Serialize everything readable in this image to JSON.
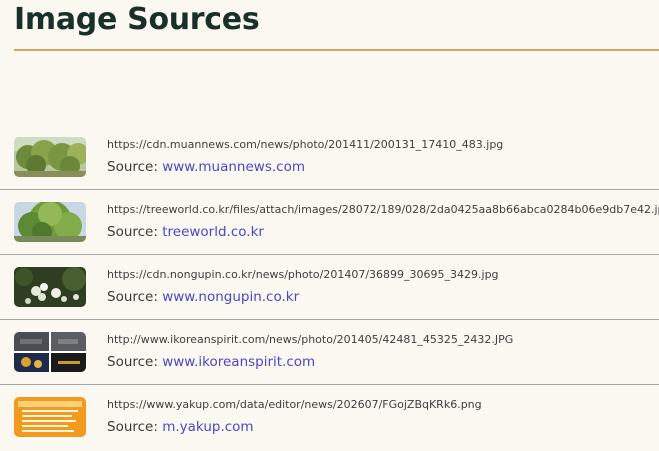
{
  "page": {
    "title": "Image Sources",
    "accent_color": "#d9a465"
  },
  "sources": [
    {
      "thumbnail_icon": "tree-photo",
      "url": "https://cdn.muannews.com/news/photo/201411/200131_17410_483.jpg",
      "source_label": "Source:",
      "source_site": "www.muannews.com"
    },
    {
      "thumbnail_icon": "tree-photo",
      "url": "https://treeworld.co.kr/files/attach/images/28072/189/028/2da0425aa8b66abca0284b06e9db7e42.jpg",
      "source_label": "Source:",
      "source_site": "treeworld.co.kr"
    },
    {
      "thumbnail_icon": "flower-photo",
      "url": "https://cdn.nongupin.co.kr/news/photo/201407/36899_30695_3429.jpg",
      "source_label": "Source:",
      "source_site": "www.nongupin.co.kr"
    },
    {
      "thumbnail_icon": "collage-photo",
      "url": "http://www.ikoreanspirit.com/news/photo/201405/42481_45325_2432.JPG",
      "source_label": "Source:",
      "source_site": "www.ikoreanspirit.com"
    },
    {
      "thumbnail_icon": "document-photo",
      "url": "https://www.yakup.com/data/editor/news/202607/FGojZBqKRk6.png",
      "source_label": "Source:",
      "source_site": "m.yakup.com"
    }
  ]
}
